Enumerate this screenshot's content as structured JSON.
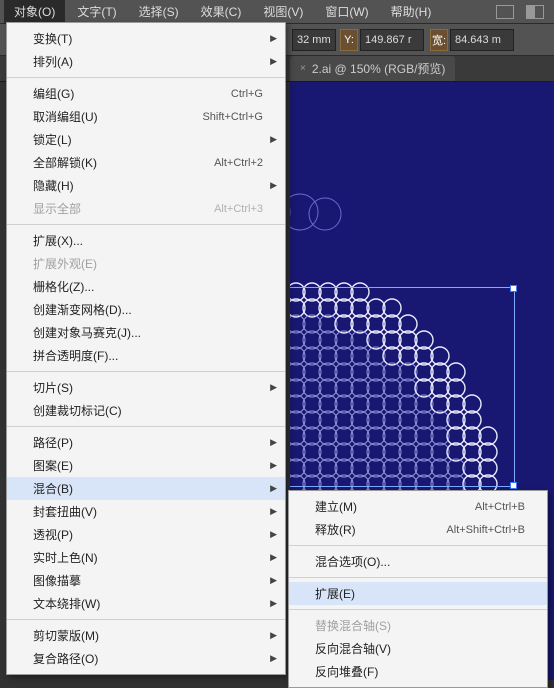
{
  "menubar": {
    "items": [
      "对象(O)",
      "文字(T)",
      "选择(S)",
      "效果(C)",
      "视图(V)",
      "窗口(W)",
      "帮助(H)"
    ],
    "active_index": 0
  },
  "toolbar": {
    "x_unit": "32 mm",
    "y_label": "Y:",
    "y_value": "149.867 r",
    "w_label": "宽:",
    "w_value": "84.643 m"
  },
  "tab": {
    "title": "2.ai @ 150% (RGB/预览)",
    "close": "×"
  },
  "menu": [
    {
      "items": [
        {
          "label": "变换(T)",
          "sub": true
        },
        {
          "label": "排列(A)",
          "sub": true
        }
      ]
    },
    {
      "items": [
        {
          "label": "编组(G)",
          "shortcut": "Ctrl+G"
        },
        {
          "label": "取消编组(U)",
          "shortcut": "Shift+Ctrl+G"
        },
        {
          "label": "锁定(L)",
          "sub": true
        },
        {
          "label": "全部解锁(K)",
          "shortcut": "Alt+Ctrl+2"
        },
        {
          "label": "隐藏(H)",
          "sub": true
        },
        {
          "label": "显示全部",
          "shortcut": "Alt+Ctrl+3",
          "disabled": true
        }
      ]
    },
    {
      "items": [
        {
          "label": "扩展(X)..."
        },
        {
          "label": "扩展外观(E)",
          "disabled": true
        },
        {
          "label": "栅格化(Z)..."
        },
        {
          "label": "创建渐变网格(D)..."
        },
        {
          "label": "创建对象马赛克(J)..."
        },
        {
          "label": "拼合透明度(F)..."
        }
      ]
    },
    {
      "items": [
        {
          "label": "切片(S)",
          "sub": true
        },
        {
          "label": "创建裁切标记(C)"
        }
      ]
    },
    {
      "items": [
        {
          "label": "路径(P)",
          "sub": true
        },
        {
          "label": "图案(E)",
          "sub": true
        },
        {
          "label": "混合(B)",
          "sub": true,
          "highlighted": true
        },
        {
          "label": "封套扭曲(V)",
          "sub": true
        },
        {
          "label": "透视(P)",
          "sub": true
        },
        {
          "label": "实时上色(N)",
          "sub": true
        },
        {
          "label": "图像描摹",
          "sub": true
        },
        {
          "label": "文本绕排(W)",
          "sub": true
        }
      ]
    },
    {
      "items": [
        {
          "label": "剪切蒙版(M)",
          "sub": true
        },
        {
          "label": "复合路径(O)",
          "sub": true
        }
      ]
    }
  ],
  "submenu": [
    {
      "items": [
        {
          "label": "建立(M)",
          "shortcut": "Alt+Ctrl+B"
        },
        {
          "label": "释放(R)",
          "shortcut": "Alt+Shift+Ctrl+B"
        }
      ]
    },
    {
      "items": [
        {
          "label": "混合选项(O)..."
        }
      ]
    },
    {
      "items": [
        {
          "label": "扩展(E)",
          "highlighted": true
        }
      ]
    },
    {
      "items": [
        {
          "label": "替换混合轴(S)",
          "disabled": true
        },
        {
          "label": "反向混合轴(V)"
        },
        {
          "label": "反向堆叠(F)"
        }
      ]
    }
  ]
}
